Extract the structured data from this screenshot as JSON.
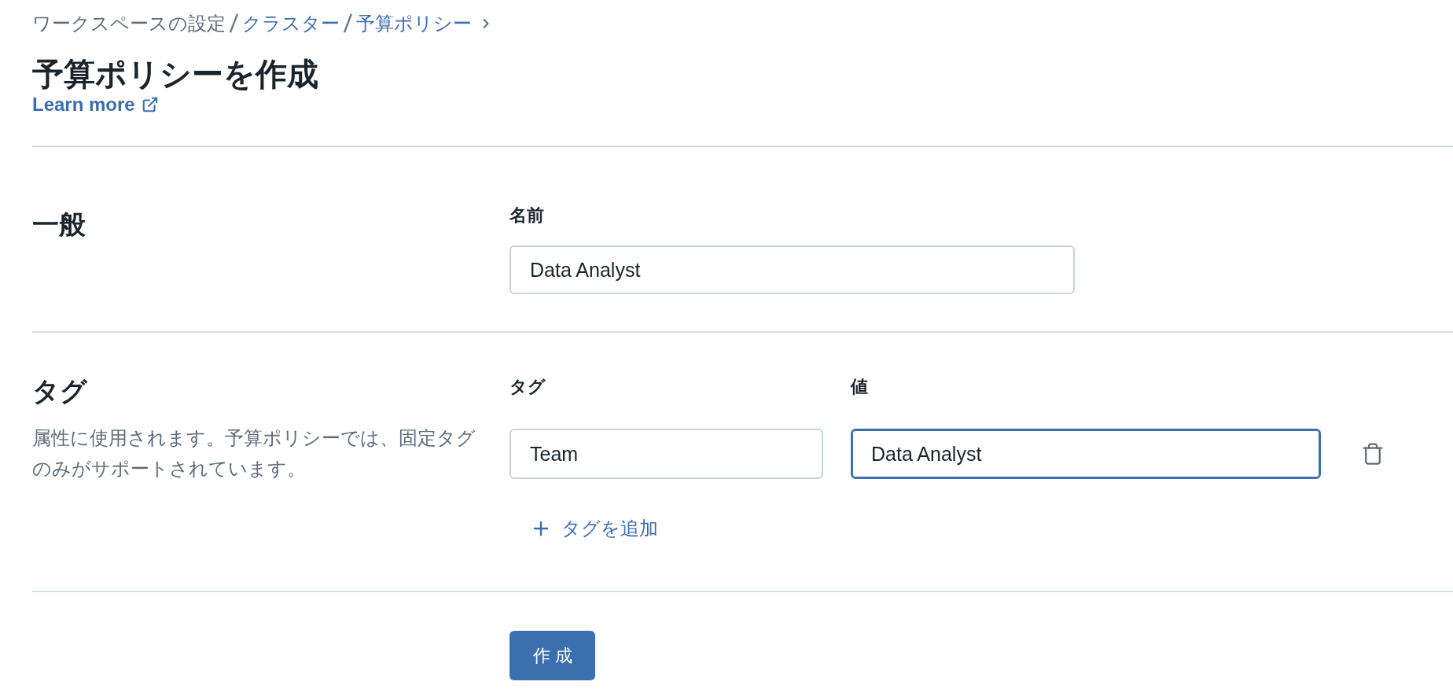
{
  "breadcrumb": {
    "items": [
      {
        "label": "ワークスペースの設定",
        "link": false,
        "separator": "/"
      },
      {
        "label": "クラスター",
        "link": true,
        "separator": "/"
      },
      {
        "label": "予算ポリシー",
        "link": true
      }
    ]
  },
  "page_title": "予算ポリシーを作成",
  "learn_more": {
    "label": "Learn more"
  },
  "sections": [
    {
      "kind": "general",
      "title": "一般",
      "fields": [
        {
          "label": "名前",
          "value": "Data Analyst",
          "focused": false
        }
      ]
    },
    {
      "kind": "tags",
      "title": "タグ",
      "description": "属性に使用されます。予算ポリシーでは、固定タグのみがサポートされています。",
      "columns": [
        "タグ",
        "値"
      ],
      "rows": [
        {
          "tag": {
            "value": "Team",
            "focused": false
          },
          "value": {
            "value": "Data Analyst",
            "focused": true
          }
        }
      ],
      "add_label": "タグを追加"
    }
  ],
  "submit": {
    "label": "作成"
  }
}
